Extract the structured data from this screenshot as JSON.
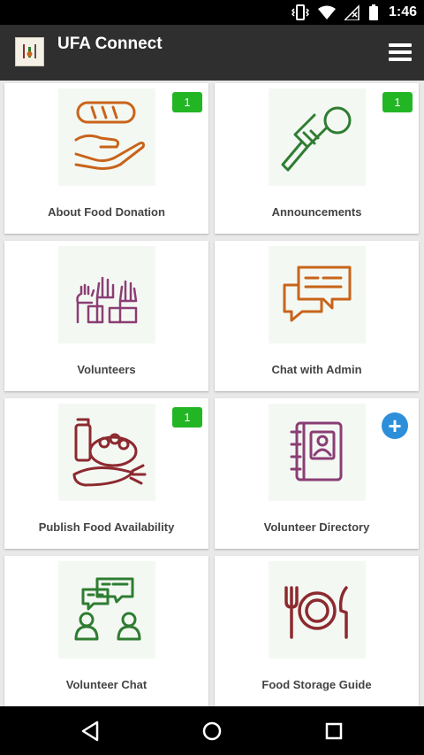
{
  "status_bar": {
    "time": "1:46",
    "icons": [
      "vibrate-icon",
      "wifi-icon",
      "signal-no-data-icon",
      "battery-icon"
    ]
  },
  "app_bar": {
    "title": "UFA Connect",
    "menu_icon": "hamburger-menu-icon"
  },
  "tiles": [
    {
      "label": "About Food Donation",
      "icon": "bread-hand-icon",
      "badge": "1"
    },
    {
      "label": "Announcements",
      "icon": "microphone-icon",
      "badge": "1"
    },
    {
      "label": "Volunteers",
      "icon": "raised-hands-icon"
    },
    {
      "label": "Chat with Admin",
      "icon": "chat-bubbles-icon"
    },
    {
      "label": "Publish Food Availability",
      "icon": "food-groceries-icon",
      "badge": "1"
    },
    {
      "label": "Volunteer Directory",
      "icon": "address-book-icon",
      "action": "+"
    },
    {
      "label": "Volunteer Chat",
      "icon": "people-chat-icon"
    },
    {
      "label": "Food Storage Guide",
      "icon": "plate-fork-knife-icon"
    }
  ],
  "colors": {
    "badge_green": "#22b524",
    "plus_blue": "#2d8fd9",
    "app_bar": "#2f2f2f",
    "icon_orange": "#c8641a",
    "icon_green": "#2f7d32",
    "icon_purple": "#8a3e74",
    "icon_red": "#8c2a2f"
  },
  "nav_bar": {
    "buttons": [
      "back-icon",
      "home-icon",
      "recents-icon"
    ]
  }
}
